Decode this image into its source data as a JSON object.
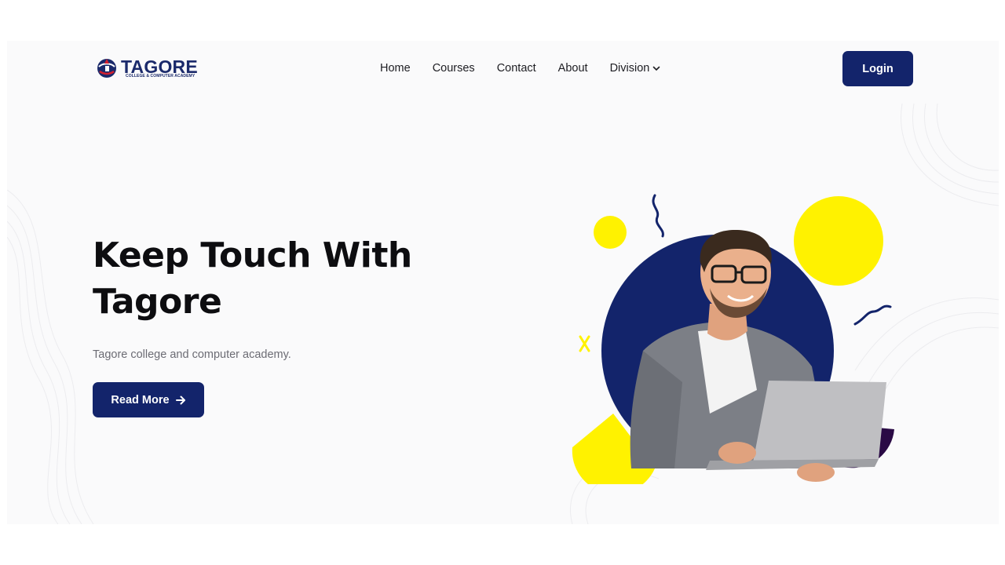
{
  "header": {
    "logo": {
      "name": "TAGORE",
      "tagline": "COLLEGE & COMPUTER ACADEMY",
      "icon": "globe-book-logo-icon"
    },
    "nav": [
      {
        "label": "Home"
      },
      {
        "label": "Courses"
      },
      {
        "label": "Contact"
      },
      {
        "label": "About"
      },
      {
        "label": "Division",
        "icon": "chevron-down-icon"
      }
    ],
    "login_label": "Login"
  },
  "hero": {
    "title_line1": "Keep Touch With",
    "title_line2": "Tagore",
    "subtitle": "Tagore college and computer academy.",
    "read_more_label": "Read More",
    "read_more_icon": "arrow-right-icon",
    "image": "student-with-laptop-illustration"
  },
  "colors": {
    "brand_navy": "#13246b",
    "accent_yellow": "#fff200",
    "accent_purple": "#2a0a45",
    "background": "#fafafb"
  }
}
